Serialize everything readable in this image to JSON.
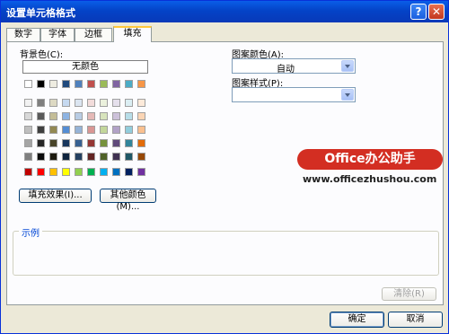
{
  "window": {
    "title": "设置单元格格式"
  },
  "tabs": [
    {
      "label": "数字"
    },
    {
      "label": "字体"
    },
    {
      "label": "边框"
    },
    {
      "label": "填充"
    }
  ],
  "background": {
    "label": "背景色(C):",
    "no_color_label": "无颜色",
    "theme_row": [
      "#ffffff",
      "#000000",
      "#eeece1",
      "#1f497d",
      "#4f81bd",
      "#c0504d",
      "#9bbb59",
      "#8064a2",
      "#4bacc6",
      "#f79646"
    ],
    "tint_rows": [
      [
        "#f2f2f2",
        "#7f7f7f",
        "#ddd9c3",
        "#c6d9f0",
        "#dbe5f1",
        "#f2dcdb",
        "#ebf1dd",
        "#e5e0ec",
        "#dbeef3",
        "#fdeada"
      ],
      [
        "#d8d8d8",
        "#595959",
        "#c4bd97",
        "#8db3e2",
        "#b8cce4",
        "#e5b9b7",
        "#d7e3bc",
        "#ccc1d9",
        "#b7dde8",
        "#fbd5b5"
      ],
      [
        "#bfbfbf",
        "#3f3f3f",
        "#938953",
        "#548dd4",
        "#95b3d7",
        "#d99694",
        "#c3d69b",
        "#b2a2c7",
        "#92cddc",
        "#fac08f"
      ],
      [
        "#a5a5a5",
        "#262626",
        "#494429",
        "#17365d",
        "#366092",
        "#953734",
        "#76923c",
        "#5f497a",
        "#31859b",
        "#e36c09"
      ],
      [
        "#7f7f7f",
        "#0c0c0c",
        "#1d1b10",
        "#0f243e",
        "#244061",
        "#632423",
        "#4f6128",
        "#3f3151",
        "#205867",
        "#974806"
      ]
    ],
    "standard_row": [
      "#c00000",
      "#ff0000",
      "#ffc000",
      "#ffff00",
      "#92d050",
      "#00b050",
      "#00b0f0",
      "#0070c0",
      "#002060",
      "#7030a0"
    ]
  },
  "buttons": {
    "fill_effects": "填充效果(I)...",
    "more_colors": "其他颜色(M)...",
    "clear": "清除(R)",
    "ok": "确定",
    "cancel": "取消"
  },
  "pattern": {
    "color_label": "图案颜色(A):",
    "color_value": "自动",
    "style_label": "图案样式(P):",
    "style_value": ""
  },
  "sample": {
    "label": "示例"
  },
  "watermark": {
    "brand": "Office办公助手",
    "url": "www.officezhushou.com"
  }
}
